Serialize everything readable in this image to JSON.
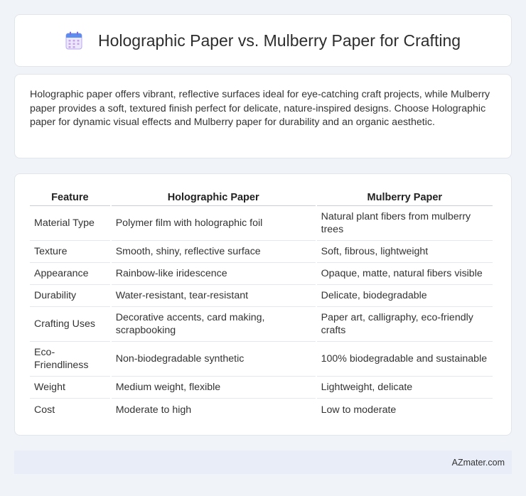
{
  "header": {
    "title": "Holographic Paper vs. Mulberry Paper for Crafting",
    "icon": "calendar-icon"
  },
  "summary": {
    "text": "Holographic paper offers vibrant, reflective surfaces ideal for eye-catching craft projects, while Mulberry paper provides a soft, textured finish perfect for delicate, nature-inspired designs. Choose Holographic paper for dynamic visual effects and Mulberry paper for durability and an organic aesthetic."
  },
  "table": {
    "headers": [
      "Feature",
      "Holographic Paper",
      "Mulberry Paper"
    ],
    "rows": [
      [
        "Material Type",
        "Polymer film with holographic foil",
        "Natural plant fibers from mulberry trees"
      ],
      [
        "Texture",
        "Smooth, shiny, reflective surface",
        "Soft, fibrous, lightweight"
      ],
      [
        "Appearance",
        "Rainbow-like iridescence",
        "Opaque, matte, natural fibers visible"
      ],
      [
        "Durability",
        "Water-resistant, tear-resistant",
        "Delicate, biodegradable"
      ],
      [
        "Crafting Uses",
        "Decorative accents, card making, scrapbooking",
        "Paper art, calligraphy, eco-friendly crafts"
      ],
      [
        "Eco-Friendliness",
        "Non-biodegradable synthetic",
        "100% biodegradable and sustainable"
      ],
      [
        "Weight",
        "Medium weight, flexible",
        "Lightweight, delicate"
      ],
      [
        "Cost",
        "Moderate to high",
        "Low to moderate"
      ]
    ]
  },
  "footer": {
    "site": "AZmater.com"
  }
}
